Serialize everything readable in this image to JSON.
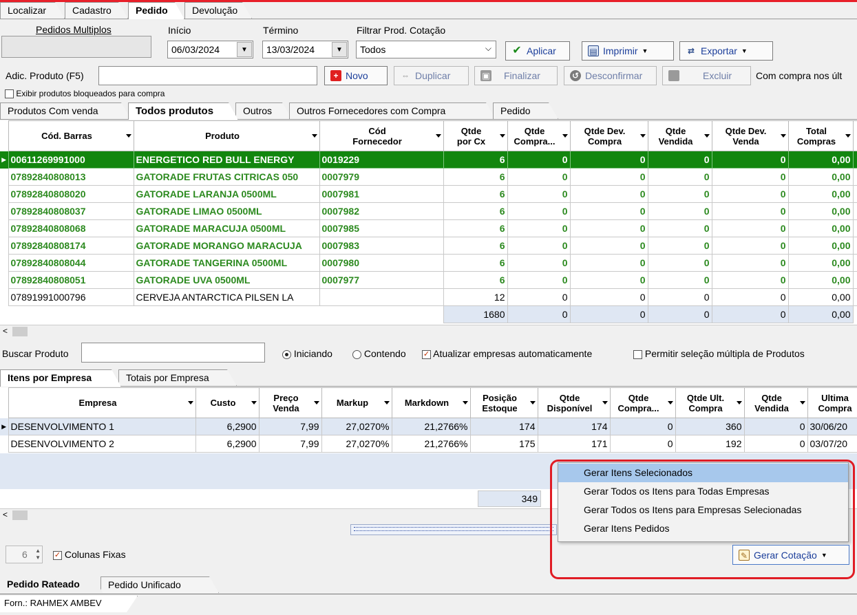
{
  "top_tabs": [
    "Localizar",
    "Cadastro",
    "Pedido",
    "Devolução"
  ],
  "header": {
    "pedidos_multiplos": "Pedidos Multiplos",
    "inicio_label": "Início",
    "inicio_value": "06/03/2024",
    "termino_label": "Término",
    "termino_value": "13/03/2024",
    "filtrar_label": "Filtrar Prod. Cotação",
    "filtrar_value": "Todos",
    "aplicar": "Aplicar",
    "imprimir": "Imprimir",
    "exportar": "Exportar"
  },
  "toolbar": {
    "adic_label": "Adic. Produto (F5)",
    "novo": "Novo",
    "duplicar": "Duplicar",
    "finalizar": "Finalizar",
    "desconfirmar": "Desconfirmar",
    "excluir": "Excluir",
    "com_compra": "Com compra nos últ",
    "exibir_bloqueados": "Exibir produtos bloqueados para compra"
  },
  "product_tabs": [
    "Produtos Com venda",
    "Todos produtos",
    "Outros",
    "Outros Fornecedores com Compra",
    "Pedido"
  ],
  "products": {
    "columns": [
      "Cód. Barras",
      "Produto",
      "Cód Fornecedor",
      "Qtde por Cx",
      "Qtde Compra...",
      "Qtde Dev. Compra",
      "Qtde Vendida",
      "Qtde Dev. Venda",
      "Total Compras"
    ],
    "rows": [
      {
        "barcode": "00611269991000",
        "product": "ENERGETICO RED BULL ENERGY",
        "supplier_code": "0019229",
        "qty_box": "6",
        "qty_buy": "0",
        "qty_dev_buy": "0",
        "qty_sold": "0",
        "qty_dev_sale": "0",
        "total": "0,00"
      },
      {
        "barcode": "07892840808013",
        "product": "GATORADE FRUTAS CITRICAS 050",
        "supplier_code": "0007979",
        "qty_box": "6",
        "qty_buy": "0",
        "qty_dev_buy": "0",
        "qty_sold": "0",
        "qty_dev_sale": "0",
        "total": "0,00"
      },
      {
        "barcode": "07892840808020",
        "product": "GATORADE LARANJA 0500ML",
        "supplier_code": "0007981",
        "qty_box": "6",
        "qty_buy": "0",
        "qty_dev_buy": "0",
        "qty_sold": "0",
        "qty_dev_sale": "0",
        "total": "0,00"
      },
      {
        "barcode": "07892840808037",
        "product": "GATORADE LIMAO 0500ML",
        "supplier_code": "0007982",
        "qty_box": "6",
        "qty_buy": "0",
        "qty_dev_buy": "0",
        "qty_sold": "0",
        "qty_dev_sale": "0",
        "total": "0,00"
      },
      {
        "barcode": "07892840808068",
        "product": "GATORADE MARACUJA 0500ML",
        "supplier_code": "0007985",
        "qty_box": "6",
        "qty_buy": "0",
        "qty_dev_buy": "0",
        "qty_sold": "0",
        "qty_dev_sale": "0",
        "total": "0,00"
      },
      {
        "barcode": "07892840808174",
        "product": "GATORADE MORANGO MARACUJA",
        "supplier_code": "0007983",
        "qty_box": "6",
        "qty_buy": "0",
        "qty_dev_buy": "0",
        "qty_sold": "0",
        "qty_dev_sale": "0",
        "total": "0,00"
      },
      {
        "barcode": "07892840808044",
        "product": "GATORADE TANGERINA 0500ML",
        "supplier_code": "0007980",
        "qty_box": "6",
        "qty_buy": "0",
        "qty_dev_buy": "0",
        "qty_sold": "0",
        "qty_dev_sale": "0",
        "total": "0,00"
      },
      {
        "barcode": "07892840808051",
        "product": "GATORADE UVA 0500ML",
        "supplier_code": "0007977",
        "qty_box": "6",
        "qty_buy": "0",
        "qty_dev_buy": "0",
        "qty_sold": "0",
        "qty_dev_sale": "0",
        "total": "0,00"
      },
      {
        "barcode": "07891991000796",
        "product": "CERVEJA ANTARCTICA PILSEN LA",
        "supplier_code": "",
        "qty_box": "12",
        "qty_buy": "0",
        "qty_dev_buy": "0",
        "qty_sold": "0",
        "qty_dev_sale": "0",
        "total": "0,00"
      }
    ],
    "totals": {
      "qty_box": "1680",
      "qty_buy": "0",
      "qty_dev_buy": "0",
      "qty_sold": "0",
      "qty_dev_sale": "0",
      "total": "0,00"
    }
  },
  "search": {
    "label": "Buscar Produto",
    "iniciando": "Iniciando",
    "contendo": "Contendo",
    "atualizar": "Atualizar empresas automaticamente",
    "permitir": "Permitir seleção múltipla de Produtos"
  },
  "company_tabs": [
    "Itens por Empresa",
    "Totais por Empresa"
  ],
  "companies": {
    "columns": [
      "Empresa",
      "Custo",
      "Preço Venda",
      "Markup",
      "Markdown",
      "Posição Estoque",
      "Qtde Disponível",
      "Qtde Compra...",
      "Qtde Ult. Compra",
      "Qtde Vendida",
      "Ultima Compra"
    ],
    "rows": [
      {
        "name": "DESENVOLVIMENTO 1",
        "cost": "6,2900",
        "price": "7,99",
        "markup": "27,0270%",
        "markdown": "21,2766%",
        "stock": "174",
        "available": "174",
        "buying": "0",
        "last_qty": "360",
        "sold": "0",
        "last_buy": "30/06/20"
      },
      {
        "name": "DESENVOLVIMENTO 2",
        "cost": "6,2900",
        "price": "7,99",
        "markup": "27,0270%",
        "markdown": "21,2766%",
        "stock": "175",
        "available": "171",
        "buying": "0",
        "last_qty": "192",
        "sold": "0",
        "last_buy": "03/07/20"
      }
    ],
    "total_stock": "349"
  },
  "context_menu": {
    "items": [
      "Gerar Itens Selecionados",
      "Gerar Todos os Itens para Todas Empresas",
      "Gerar Todos os Itens para Empresas Selecionadas",
      "Gerar Itens Pedidos"
    ]
  },
  "footer": {
    "spin_value": "6",
    "colunas_fixas": "Colunas Fixas",
    "gerar_cotacao": "Gerar Cotação"
  },
  "bottom_tabs": [
    "Pedido Rateado",
    "Pedido Unificado"
  ],
  "status": "Forn.: RAHMEX AMBEV"
}
